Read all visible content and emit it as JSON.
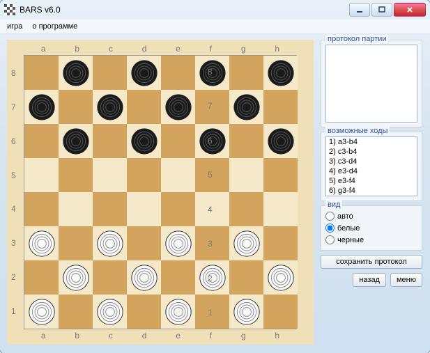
{
  "window": {
    "title": "BARS v6.0"
  },
  "menu": {
    "items": [
      "игра",
      "о программе"
    ]
  },
  "board": {
    "files": [
      "a",
      "b",
      "c",
      "d",
      "e",
      "f",
      "g",
      "h"
    ],
    "ranks": [
      "8",
      "7",
      "6",
      "5",
      "4",
      "3",
      "2",
      "1"
    ],
    "black": [
      "b8",
      "d8",
      "f8",
      "h8",
      "a7",
      "c7",
      "e7",
      "g7",
      "b6",
      "d6",
      "f6",
      "h6"
    ],
    "white": [
      "a3",
      "c3",
      "e3",
      "g3",
      "b2",
      "d2",
      "f2",
      "h2",
      "a1",
      "c1",
      "e1",
      "g1"
    ]
  },
  "protocol": {
    "label": "протокол партии"
  },
  "moves": {
    "label": "возможные ходы",
    "items": [
      "1)  a3-b4",
      "2)  c3-b4",
      "3)  c3-d4",
      "4)  e3-d4",
      "5)  e3-f4",
      "6)  g3-f4"
    ]
  },
  "view": {
    "label": "вид",
    "options": [
      {
        "label": "авто",
        "checked": false
      },
      {
        "label": "белые",
        "checked": true
      },
      {
        "label": "черные",
        "checked": false
      }
    ]
  },
  "buttons": {
    "save": "сохранить протокол",
    "back": "назад",
    "menu": "меню"
  }
}
